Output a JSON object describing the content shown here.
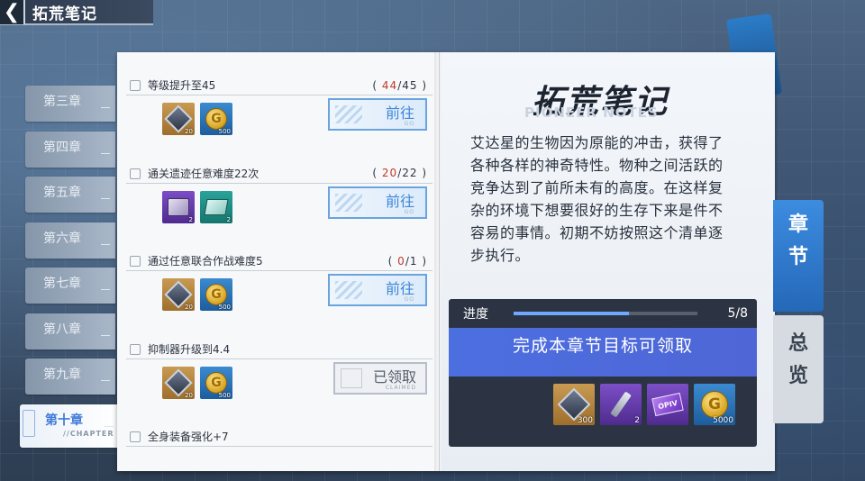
{
  "header": {
    "title": "拓荒笔记",
    "back_symbol": "❮"
  },
  "chapters": [
    {
      "label": "第三章",
      "active": false
    },
    {
      "label": "第四章",
      "active": false
    },
    {
      "label": "第五章",
      "active": false
    },
    {
      "label": "第六章",
      "active": false
    },
    {
      "label": "第七章",
      "active": false
    },
    {
      "label": "第八章",
      "active": false
    },
    {
      "label": "第九章",
      "active": false
    },
    {
      "label": "第十章",
      "active": true,
      "sub": "//CHAPTER"
    }
  ],
  "tasks": [
    {
      "title": "等级提升至45",
      "progress_current": "44",
      "progress_total": "/45",
      "rewards": [
        {
          "icon": "cube-icon",
          "rarity": "orange",
          "qty": "20"
        },
        {
          "icon": "coin-icon",
          "rarity": "blue",
          "qty": "500"
        }
      ],
      "action": "前往",
      "action_sub": "GO",
      "state": "go"
    },
    {
      "title": "通关遗迹任意难度22次",
      "progress_current": "20",
      "progress_total": "/22",
      "rewards": [
        {
          "icon": "crate-icon",
          "rarity": "purple",
          "qty": "2"
        },
        {
          "icon": "chip-icon",
          "rarity": "teal",
          "qty": "2"
        }
      ],
      "action": "前往",
      "action_sub": "GO",
      "state": "go"
    },
    {
      "title": "通过任意联合作战难度5",
      "progress_current": "0",
      "progress_total": "/1",
      "rewards": [
        {
          "icon": "cube-icon",
          "rarity": "orange",
          "qty": "20"
        },
        {
          "icon": "coin-icon",
          "rarity": "blue",
          "qty": "500"
        }
      ],
      "action": "前往",
      "action_sub": "GO",
      "state": "go"
    },
    {
      "title": "抑制器升级到4.4",
      "progress_current": "",
      "progress_total": "",
      "rewards": [
        {
          "icon": "cube-icon",
          "rarity": "orange",
          "qty": "20"
        },
        {
          "icon": "coin-icon",
          "rarity": "blue",
          "qty": "500"
        }
      ],
      "action": "已领取",
      "action_sub": "CLAIMED",
      "state": "claimed"
    },
    {
      "title": "全身装备强化+7",
      "progress_current": "",
      "progress_total": "",
      "rewards": [],
      "action": "",
      "action_sub": "",
      "state": "partial"
    }
  ],
  "notes": {
    "title": "拓荒笔记",
    "subtitle": "PIONEER NOTES",
    "description": "艾达星的生物因为原能的冲击，获得了各种各样的神奇特性。物种之间活跃的竞争达到了前所未有的高度。在这样复杂的环境下想要很好的生存下来是件不容易的事情。初期不妨按照这个清单逐步执行。"
  },
  "chapter_progress": {
    "label": "进度",
    "count": "5/8",
    "fraction": 0.625,
    "claim_text": "完成本章节目标可领取",
    "rewards": [
      {
        "icon": "cube-icon",
        "rarity": "orange",
        "qty": "300"
      },
      {
        "icon": "wrench-icon",
        "rarity": "purple",
        "qty": "2"
      },
      {
        "icon": "ticket-icon",
        "rarity": "purple",
        "qty": "",
        "text": "OPIV"
      },
      {
        "icon": "coin-icon",
        "rarity": "blue",
        "qty": "5000"
      }
    ]
  },
  "side_tabs": [
    {
      "label": "章节",
      "active": true
    },
    {
      "label": "总览",
      "active": false
    }
  ],
  "colors": {
    "accent": "#3f87d8",
    "progress_fill": "#6ea8ff",
    "claim_banner": "#4c6fe0",
    "progress_highlight": "#c0392b"
  }
}
